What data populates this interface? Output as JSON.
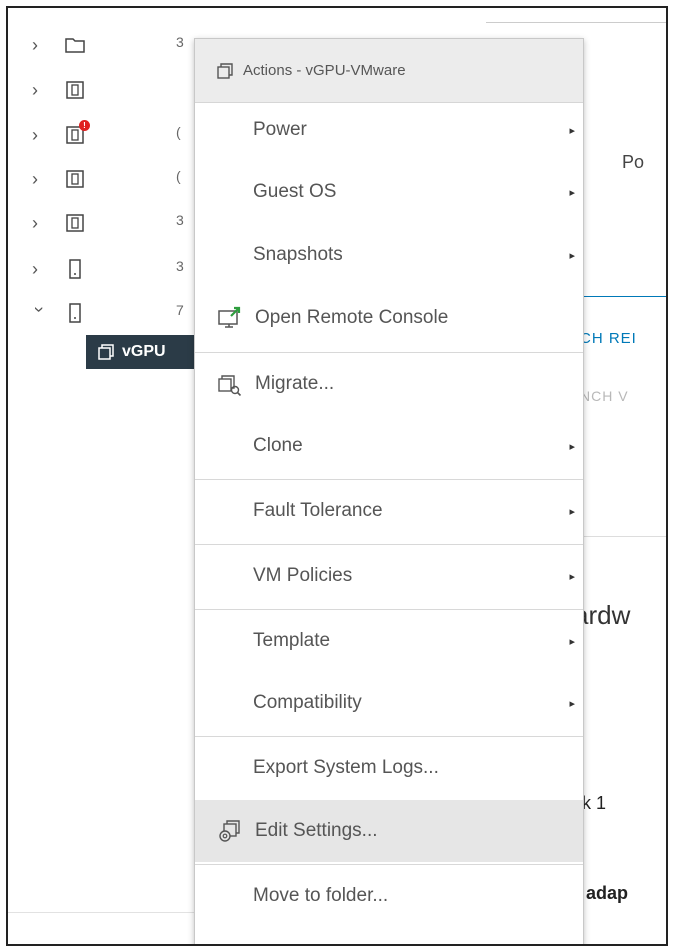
{
  "tree": {
    "rows": [
      {
        "icon": "folder-icon",
        "expanded": false,
        "alert": false,
        "trunc": "3"
      },
      {
        "icon": "host-icon",
        "expanded": false,
        "alert": false,
        "trunc": ""
      },
      {
        "icon": "host-alert-icon",
        "expanded": false,
        "alert": true,
        "trunc": "("
      },
      {
        "icon": "host-icon",
        "expanded": false,
        "alert": false,
        "trunc": "("
      },
      {
        "icon": "host-icon",
        "expanded": false,
        "alert": false,
        "trunc": "3"
      },
      {
        "icon": "server-icon",
        "expanded": false,
        "alert": false,
        "trunc": "3"
      },
      {
        "icon": "server-icon",
        "expanded": true,
        "alert": false,
        "trunc": "7"
      }
    ],
    "selected_vm": "vGPU"
  },
  "background": {
    "po_label": "Po",
    "launch_remote": "CH REI",
    "launch_web": "NCH V",
    "hardware_label": "ardw",
    "disk_label": "k 1",
    "adapter_label": "adap"
  },
  "menu": {
    "header": "Actions - vGPU-VMware",
    "items": {
      "power": "Power",
      "guest_os": "Guest OS",
      "snapshots": "Snapshots",
      "open_remote_console": "Open Remote Console",
      "migrate": "Migrate...",
      "clone": "Clone",
      "fault_tolerance": "Fault Tolerance",
      "vm_policies": "VM Policies",
      "template": "Template",
      "compatibility": "Compatibility",
      "export_system_logs": "Export System Logs...",
      "edit_settings": "Edit Settings...",
      "move_to_folder": "Move to folder..."
    },
    "submenu_arrow": "▸",
    "hovered_item": "edit_settings"
  },
  "colors": {
    "selected_bg": "#2b3b47",
    "link_blue": "#0079b8",
    "alert_red": "#e02020",
    "console_green": "#2e9e3e"
  }
}
